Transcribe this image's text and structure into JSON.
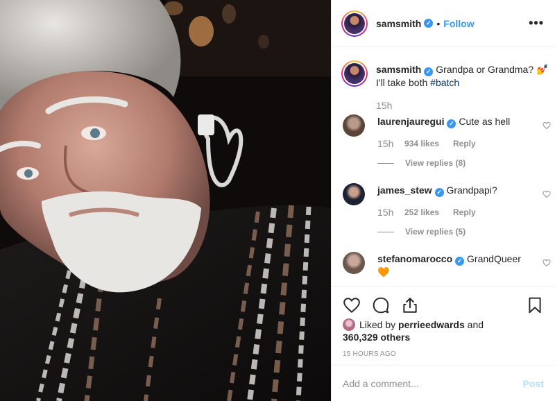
{
  "header": {
    "username": "samsmith",
    "verified_mark": "✓",
    "separator": "•",
    "follow_label": "Follow",
    "more_label": "•••"
  },
  "caption": {
    "username": "samsmith",
    "text": "Grandpa or Grandma? 💅 I'll take both ",
    "hashtag": "#batch",
    "time": "15h"
  },
  "comments": [
    {
      "username": "laurenjauregui",
      "text": "Cute as hell",
      "time": "15h",
      "likes": "934 likes",
      "reply": "Reply",
      "view_replies": "View replies (8)"
    },
    {
      "username": "james_stew",
      "text": "Grandpapi?",
      "time": "15h",
      "likes": "252 likes",
      "reply": "Reply",
      "view_replies": "View replies (5)"
    },
    {
      "username": "stefanomarocco",
      "text": "GrandQueer",
      "emoji": "🧡"
    }
  ],
  "likes": {
    "prefix": "Liked by ",
    "user": "perrieedwards",
    "middle": " and",
    "count": "360,329 others"
  },
  "timestamp": "15 HOURS AGO",
  "comment_box": {
    "placeholder": "Add a comment...",
    "post_label": "Post"
  },
  "icons": {
    "like": "heart-icon",
    "comment": "comment-icon",
    "share": "share-icon",
    "save": "bookmark-icon",
    "more": "more-icon"
  },
  "colors": {
    "link_blue": "#3897f0",
    "post_disabled": "#b2dffc",
    "muted": "#8e8e8e",
    "text": "#262626"
  }
}
